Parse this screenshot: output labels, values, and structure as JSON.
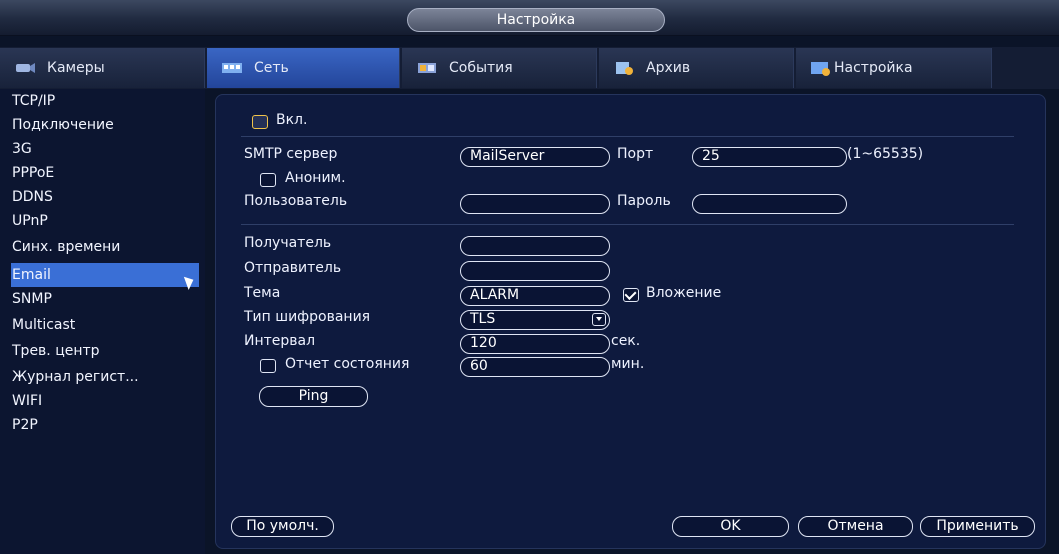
{
  "window": {
    "title": "Настройка"
  },
  "tabs": [
    {
      "label": "Камеры",
      "icon": "camera-icon"
    },
    {
      "label": "Сеть",
      "icon": "network-icon"
    },
    {
      "label": "События",
      "icon": "events-icon"
    },
    {
      "label": "Архив",
      "icon": "archive-icon"
    },
    {
      "label": "Настройка",
      "icon": "settings-icon"
    }
  ],
  "sidebar": {
    "items": [
      "TCP/IP",
      "Подключение",
      "3G",
      "PPPoE",
      "DDNS",
      "UPnP",
      "Синх. времени",
      "Email",
      "SNMP",
      "Multicast",
      "Трев. центр",
      "Журнал регист...",
      "WIFI",
      "P2P"
    ],
    "active": "Email"
  },
  "email": {
    "enable_label": "Вкл.",
    "smtp_label": "SMTP сервер",
    "smtp_value": "MailServer",
    "port_label": "Порт",
    "port_value": "25",
    "port_range": "(1~65535)",
    "anon_label": "Аноним.",
    "user_label": "Пользователь",
    "user_value": "",
    "password_label": "Пароль",
    "password_value": "",
    "recipient_label": "Получатель",
    "recipient_value": "",
    "sender_label": "Отправитель",
    "sender_value": "",
    "subject_label": "Тема",
    "subject_value": "ALARM",
    "attachment_label": "Вложение",
    "attachment_checked": true,
    "encryption_label": "Тип шифрования",
    "encryption_value": "TLS",
    "interval_label": "Интервал",
    "interval_value": "120",
    "interval_unit": "сек.",
    "health_label": "Отчет состояния",
    "health_value": "60",
    "health_unit": "мин.",
    "ping_label": "Ping"
  },
  "footer": {
    "default_label": "По умолч.",
    "ok_label": "OK",
    "cancel_label": "Отмена",
    "apply_label": "Применить"
  },
  "colors": {
    "accent": "#3a6fd6",
    "panel": "#0e1a3e",
    "enable_checkbox": "#f0c34a"
  }
}
